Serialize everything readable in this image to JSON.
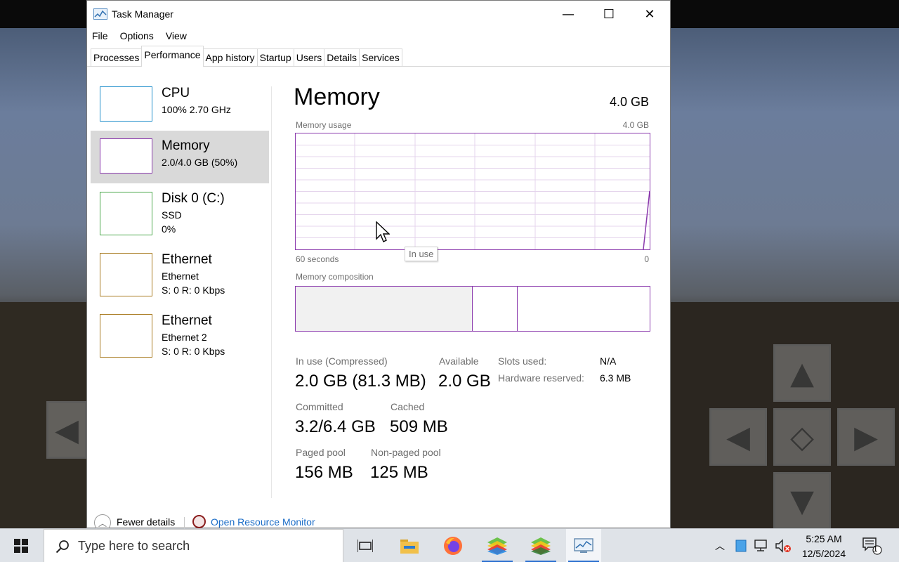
{
  "window": {
    "title": "Task Manager",
    "controls": {
      "minimize": "—",
      "maximize": "☐",
      "close": "✕"
    }
  },
  "menu": [
    "File",
    "Options",
    "View"
  ],
  "tabs": [
    "Processes",
    "Performance",
    "App history",
    "Startup",
    "Users",
    "Details",
    "Services"
  ],
  "active_tab": "Performance",
  "sidebar": [
    {
      "title": "CPU",
      "sub1": "100%  2.70 GHz",
      "sub2": "",
      "color": "#1f8ecb"
    },
    {
      "title": "Memory",
      "sub1": "2.0/4.0 GB (50%)",
      "sub2": "",
      "color": "#8b3aad"
    },
    {
      "title": "Disk 0 (C:)",
      "sub1": "SSD",
      "sub2": "0%",
      "color": "#4ca84c"
    },
    {
      "title": "Ethernet",
      "sub1": "Ethernet",
      "sub2": "S: 0 R: 0 Kbps",
      "color": "#a87a1f"
    },
    {
      "title": "Ethernet",
      "sub1": "Ethernet 2",
      "sub2": "S: 0 R: 0 Kbps",
      "color": "#a87a1f"
    }
  ],
  "selected_sidebar": "Memory",
  "panel": {
    "title": "Memory",
    "total": "4.0 GB",
    "usage_label": "Memory usage",
    "usage_max": "4.0 GB",
    "time_label": "60 seconds",
    "time_end": "0",
    "composition_label": "Memory composition",
    "tooltip": "In use",
    "composition": {
      "in_use_fraction": 0.5,
      "modified_fraction": 0.125
    }
  },
  "stats": {
    "in_use": {
      "label": "In use (Compressed)",
      "value": "2.0 GB (81.3 MB)"
    },
    "available": {
      "label": "Available",
      "value": "2.0 GB"
    },
    "committed": {
      "label": "Committed",
      "value": "3.2/6.4 GB"
    },
    "cached": {
      "label": "Cached",
      "value": "509 MB"
    },
    "paged_pool": {
      "label": "Paged pool",
      "value": "156 MB"
    },
    "non_paged_pool": {
      "label": "Non-paged pool",
      "value": "125 MB"
    },
    "slots_used": {
      "label": "Slots used:",
      "value": "N/A"
    },
    "hw_reserved": {
      "label": "Hardware reserved:",
      "value": "6.3 MB"
    }
  },
  "footer": {
    "fewer": "Fewer details",
    "resource_monitor": "Open Resource Monitor"
  },
  "taskbar": {
    "search_placeholder": "Type here to search",
    "time": "5:25 AM",
    "date": "12/5/2024",
    "notification_count": "1"
  }
}
